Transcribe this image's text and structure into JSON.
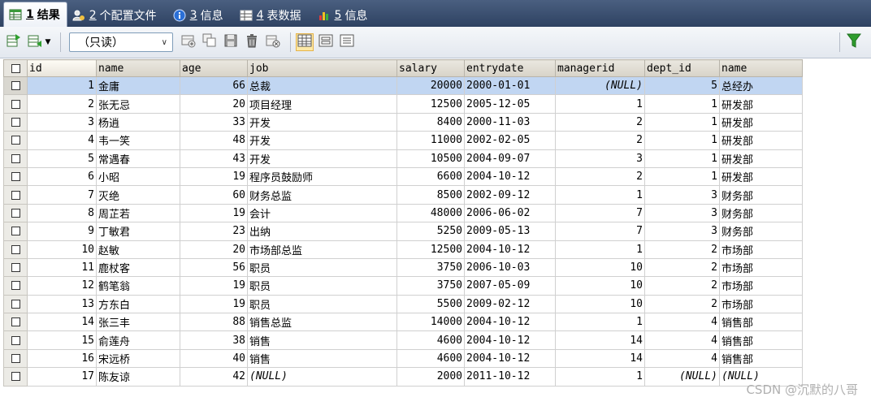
{
  "tabs": [
    {
      "num": "1",
      "label": "结果",
      "icon": "grid-result-icon",
      "active": true
    },
    {
      "num": "2",
      "label": "个配置文件",
      "icon": "profile-icon",
      "active": false
    },
    {
      "num": "3",
      "label": "信息",
      "icon": "info-icon",
      "active": false
    },
    {
      "num": "4",
      "label": "表数据",
      "icon": "table-data-icon",
      "active": false
    },
    {
      "num": "5",
      "label": "信息",
      "icon": "info-chart-icon",
      "active": false
    }
  ],
  "toolbar": {
    "mode_select": "（只读）",
    "icons": [
      "export-icon",
      "import-icon",
      "dropdown-icon",
      "add-row-icon",
      "duplicate-row-icon",
      "save-icon",
      "delete-icon",
      "refresh-icon",
      "grid-view-icon",
      "form-view-icon",
      "text-view-icon",
      "filter-icon"
    ]
  },
  "grid": {
    "columns": [
      "id",
      "name",
      "age",
      "job",
      "salary",
      "entrydate",
      "managerid",
      "dept_id",
      "name"
    ],
    "rows": [
      [
        "1",
        "金庸",
        "66",
        "总裁",
        "20000",
        "2000-01-01",
        "(NULL)",
        "5",
        "总经办"
      ],
      [
        "2",
        "张无忌",
        "20",
        "项目经理",
        "12500",
        "2005-12-05",
        "1",
        "1",
        "研发部"
      ],
      [
        "3",
        "杨逍",
        "33",
        "开发",
        "8400",
        "2000-11-03",
        "2",
        "1",
        "研发部"
      ],
      [
        "4",
        "韦一笑",
        "48",
        "开发",
        "11000",
        "2002-02-05",
        "2",
        "1",
        "研发部"
      ],
      [
        "5",
        "常遇春",
        "43",
        "开发",
        "10500",
        "2004-09-07",
        "3",
        "1",
        "研发部"
      ],
      [
        "6",
        "小昭",
        "19",
        "程序员鼓励师",
        "6600",
        "2004-10-12",
        "2",
        "1",
        "研发部"
      ],
      [
        "7",
        "灭绝",
        "60",
        "财务总监",
        "8500",
        "2002-09-12",
        "1",
        "3",
        "财务部"
      ],
      [
        "8",
        "周芷若",
        "19",
        "会计",
        "48000",
        "2006-06-02",
        "7",
        "3",
        "财务部"
      ],
      [
        "9",
        "丁敏君",
        "23",
        "出纳",
        "5250",
        "2009-05-13",
        "7",
        "3",
        "财务部"
      ],
      [
        "10",
        "赵敏",
        "20",
        "市场部总监",
        "12500",
        "2004-10-12",
        "1",
        "2",
        "市场部"
      ],
      [
        "11",
        "鹿杖客",
        "56",
        "职员",
        "3750",
        "2006-10-03",
        "10",
        "2",
        "市场部"
      ],
      [
        "12",
        "鹤笔翁",
        "19",
        "职员",
        "3750",
        "2007-05-09",
        "10",
        "2",
        "市场部"
      ],
      [
        "13",
        "方东白",
        "19",
        "职员",
        "5500",
        "2009-02-12",
        "10",
        "2",
        "市场部"
      ],
      [
        "14",
        "张三丰",
        "88",
        "销售总监",
        "14000",
        "2004-10-12",
        "1",
        "4",
        "销售部"
      ],
      [
        "15",
        "俞莲舟",
        "38",
        "销售",
        "4600",
        "2004-10-12",
        "14",
        "4",
        "销售部"
      ],
      [
        "16",
        "宋远桥",
        "40",
        "销售",
        "4600",
        "2004-10-12",
        "14",
        "4",
        "销售部"
      ],
      [
        "17",
        "陈友谅",
        "42",
        "(NULL)",
        "2000",
        "2011-10-12",
        "1",
        "(NULL)",
        "(NULL)"
      ]
    ]
  },
  "watermark": "CSDN @沉默的八哥"
}
